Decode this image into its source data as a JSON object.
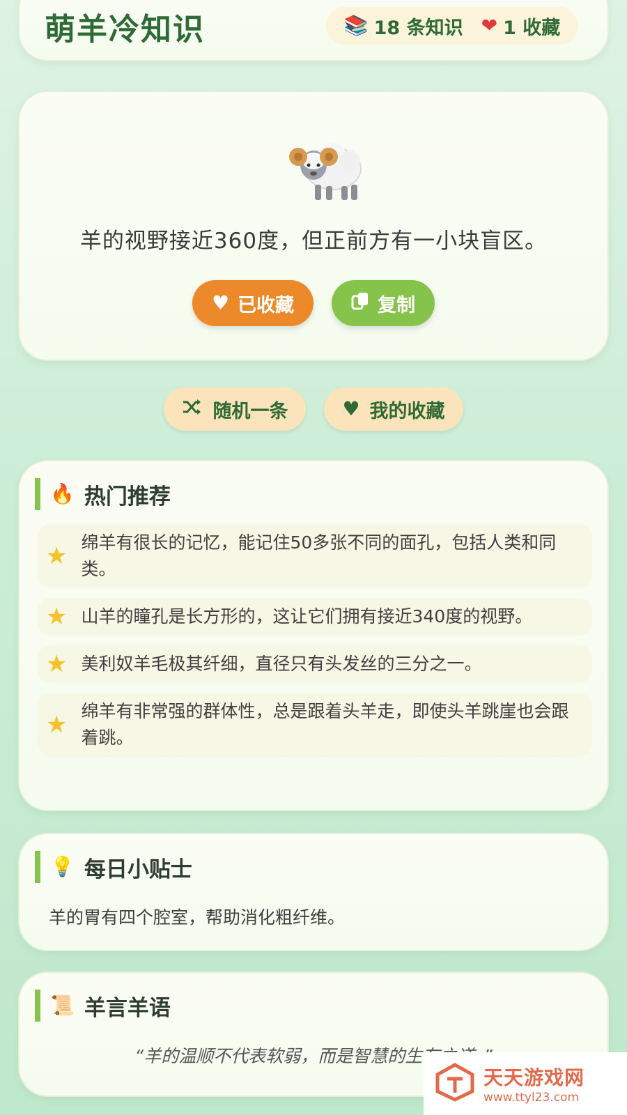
{
  "header": {
    "title": "萌羊冷知识",
    "stats": {
      "knowledge_icon": "books-icon",
      "knowledge_text": "18 条知识",
      "fav_icon": "heart-icon",
      "fav_text": "1 收藏"
    }
  },
  "fact": {
    "icon": "sheep-icon",
    "text": "羊的视野接近360度，但正前方有一小块盲区。",
    "fav_button": "已收藏",
    "copy_button": "复制"
  },
  "nav": {
    "random_label": "随机一条",
    "favorites_label": "我的收藏"
  },
  "hot": {
    "title": "热门推荐",
    "items": [
      "绵羊有很长的记忆，能记住50多张不同的面孔，包括人类和同类。",
      "山羊的瞳孔是长方形的，这让它们拥有接近340度的视野。",
      "美利奴羊毛极其纤细，直径只有头发丝的三分之一。",
      "绵羊有非常强的群体性，总是跟着头羊走，即使头羊跳崖也会跟着跳。"
    ]
  },
  "tip": {
    "title": "每日小贴士",
    "text": "羊的胃有四个腔室，帮助消化粗纤维。"
  },
  "quote": {
    "title": "羊言羊语",
    "text": "“羊的温顺不代表软弱，而是智慧的生存之道。”"
  },
  "watermark": {
    "name": "天天游戏网",
    "url": "www.ttyl23.com"
  },
  "colors": {
    "primary_green": "#2e6a36",
    "accent_green": "#86c34b",
    "accent_orange": "#ec8a2b",
    "nav_button_bg": "#fbe3bb",
    "star": "#f4c22b"
  }
}
